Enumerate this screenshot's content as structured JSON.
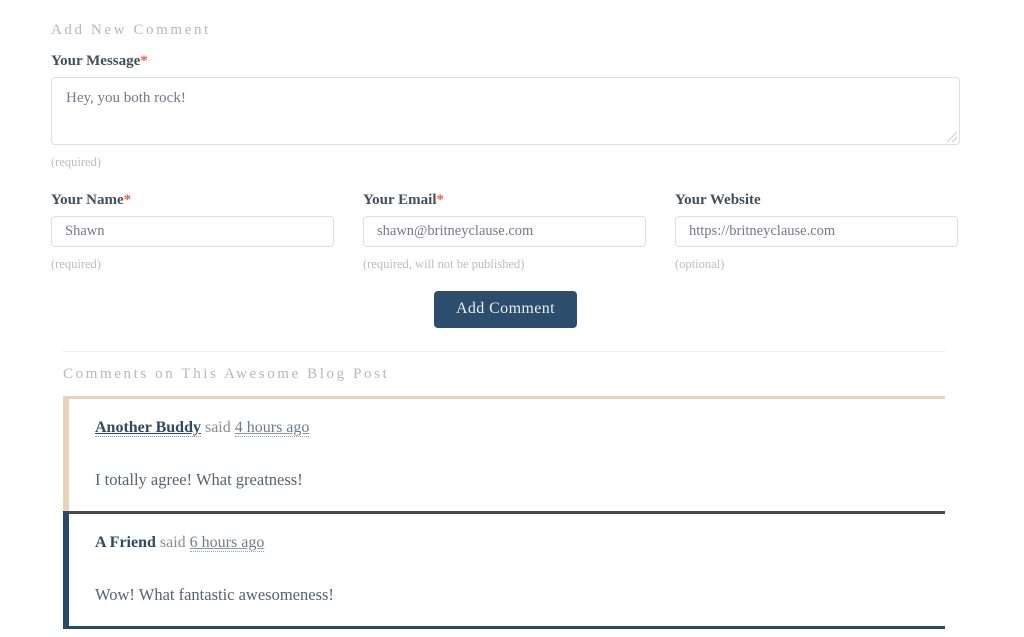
{
  "form": {
    "section_title": "Add New Comment",
    "message": {
      "label": "Your Message",
      "required_marker": "*",
      "value": "Hey, you both rock!",
      "hint": "(required)"
    },
    "name": {
      "label": "Your Name",
      "required_marker": "*",
      "value": "Shawn",
      "hint": "(required)"
    },
    "email": {
      "label": "Your Email",
      "required_marker": "*",
      "value": "shawn@britneyclause.com",
      "hint": "(required, will not be published)"
    },
    "website": {
      "label": "Your Website",
      "required_marker": "",
      "value": "https://britneyclause.com",
      "hint": "(optional)"
    },
    "submit_label": "Add Comment"
  },
  "comments": {
    "section_title": "Comments on This Awesome Blog Post",
    "items": [
      {
        "author": "Another Buddy",
        "said_label": "said",
        "time": "4 hours ago",
        "body": "I totally agree! What greatness!",
        "accent_color": "#ead2b4"
      },
      {
        "author": "A Friend",
        "said_label": "said",
        "time": "6 hours ago",
        "body": "Wow! What fantastic awesomeness!",
        "accent_color": "#27496b"
      }
    ]
  },
  "colors": {
    "accent_button": "#2c4e6c",
    "required_star": "#e8614d",
    "comment_first_accent": "#ead2b4",
    "comment_second_accent": "#27496b",
    "muted_text": "#b9b5bd"
  }
}
